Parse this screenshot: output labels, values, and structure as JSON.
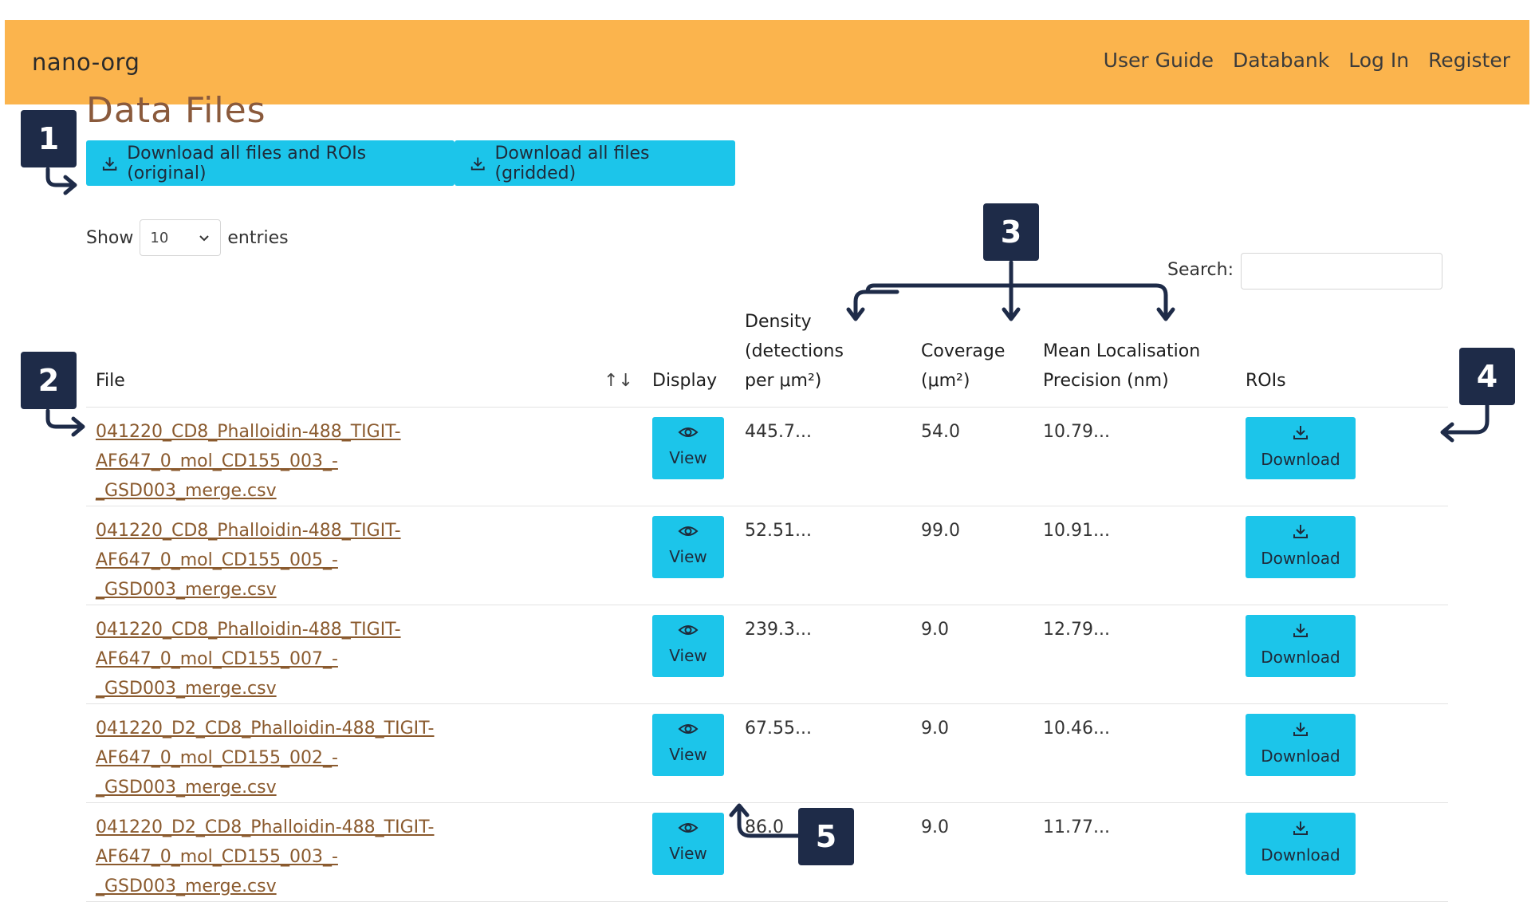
{
  "navbar": {
    "brand": "nano-org",
    "links": [
      "User Guide",
      "Databank",
      "Log In",
      "Register"
    ]
  },
  "page": {
    "title": "Data Files",
    "download_original_label": "Download all files and ROIs (original)",
    "download_gridded_label": "Download all files (gridded)"
  },
  "entries": {
    "show_label": "Show",
    "selected": "10",
    "entries_label": "entries"
  },
  "search": {
    "label": "Search:",
    "placeholder": ""
  },
  "table": {
    "headers": {
      "file": "File",
      "display": "Display",
      "density_line1": "Density (detections",
      "density_line2": "per μm²)",
      "coverage_line1": "Coverage",
      "coverage_line2": "(μm²)",
      "precision_line1": "Mean Localisation",
      "precision_line2": "Precision (nm)",
      "rois": "ROIs"
    },
    "view_label": "View",
    "download_label": "Download",
    "rows": [
      {
        "file_line1": "041220_CD8_Phalloidin-488_TIGIT-AF647_0_mol_CD155_003_-",
        "file_line2": "_GSD003_merge.csv",
        "density": "445.7...",
        "coverage": "54.0",
        "precision": "10.79..."
      },
      {
        "file_line1": "041220_CD8_Phalloidin-488_TIGIT-AF647_0_mol_CD155_005_-",
        "file_line2": "_GSD003_merge.csv",
        "density": "52.51...",
        "coverage": "99.0",
        "precision": "10.91..."
      },
      {
        "file_line1": "041220_CD8_Phalloidin-488_TIGIT-AF647_0_mol_CD155_007_-",
        "file_line2": "_GSD003_merge.csv",
        "density": "239.3...",
        "coverage": "9.0",
        "precision": "12.79..."
      },
      {
        "file_line1": "041220_D2_CD8_Phalloidin-488_TIGIT-AF647_0_mol_CD155_002_-",
        "file_line2": "_GSD003_merge.csv",
        "density": "67.55...",
        "coverage": "9.0",
        "precision": "10.46..."
      },
      {
        "file_line1": "041220_D2_CD8_Phalloidin-488_TIGIT-AF647_0_mol_CD155_003_-",
        "file_line2": "_GSD003_merge.csv",
        "density": "86.0",
        "coverage": "9.0",
        "precision": "11.77..."
      }
    ]
  },
  "callouts": [
    "1",
    "2",
    "3",
    "4",
    "5"
  ],
  "colors": {
    "navbar": "#fbb44d",
    "button": "#1cc5ea",
    "callout": "#1e2b48",
    "title": "#8a5a3c",
    "link": "#8a5a2e"
  },
  "icons": {
    "download": "download-icon",
    "view": "eye-icon",
    "sort": "sort-icon",
    "dropdown": "chevron-down-icon"
  }
}
